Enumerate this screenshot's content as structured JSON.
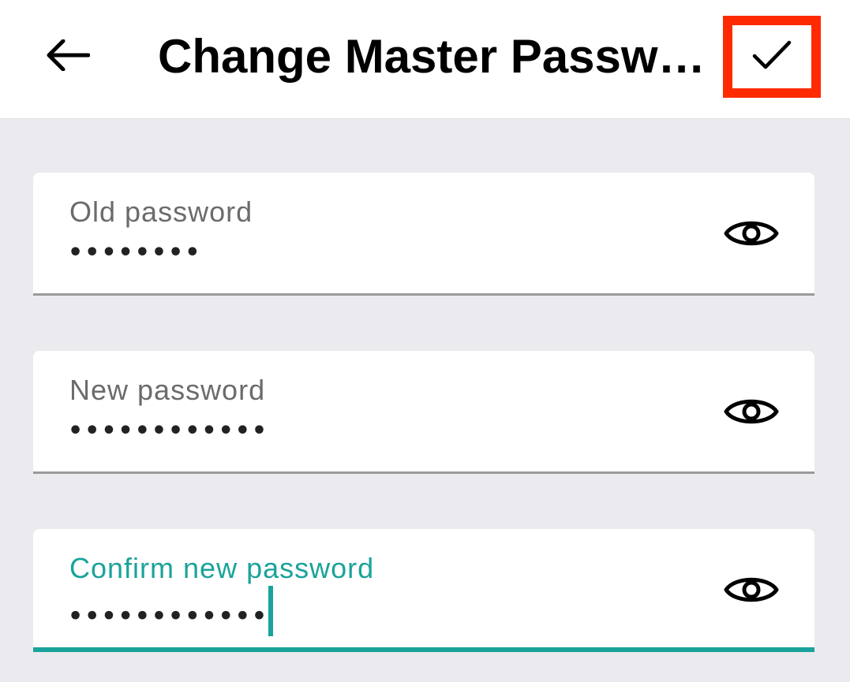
{
  "header": {
    "title": "Change Master Passw…",
    "back_icon": "arrow-left-icon",
    "confirm_icon": "checkmark-icon",
    "confirm_highlight_color": "#ff2a00"
  },
  "form": {
    "accent_color": "#1aa39a",
    "fields": [
      {
        "label": "Old password",
        "value": "••••••••",
        "focused": false,
        "toggle_icon": "eye-icon"
      },
      {
        "label": "New password",
        "value": "••••••••••••",
        "focused": false,
        "toggle_icon": "eye-icon"
      },
      {
        "label": "Confirm new password",
        "value": "••••••••••••",
        "focused": true,
        "toggle_icon": "eye-icon"
      }
    ]
  }
}
